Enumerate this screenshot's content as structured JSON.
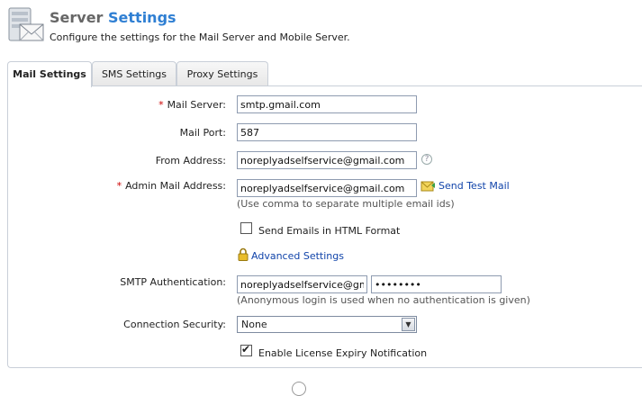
{
  "header": {
    "title_part1": "Server",
    "title_part2": "Settings",
    "subtitle": "Configure the settings for the Mail Server and Mobile Server."
  },
  "tabs": [
    {
      "label": "Mail Settings",
      "active": true
    },
    {
      "label": "SMS Settings",
      "active": false
    },
    {
      "label": "Proxy Settings",
      "active": false
    }
  ],
  "form": {
    "required_mark": "*",
    "mail_server": {
      "label": "Mail Server:",
      "value": "smtp.gmail.com"
    },
    "mail_port": {
      "label": "Mail Port:",
      "value": "587"
    },
    "from_address": {
      "label": "From Address:",
      "value": "noreplyadselfservice@gmail.com",
      "help": "?"
    },
    "admin_mail": {
      "label": "Admin Mail Address:",
      "value": "noreplyadselfservice@gmail.com",
      "send_test_label": "Send Test Mail",
      "hint": "(Use comma to separate multiple email ids)"
    },
    "html_format": {
      "label": "Send Emails in HTML Format",
      "checked": false
    },
    "advanced_label": "Advanced Settings",
    "smtp_auth": {
      "label": "SMTP Authentication:",
      "username": "noreplyadselfservice@gmail.com",
      "password": "••••••••",
      "hint": "(Anonymous login is used when no authentication is given)"
    },
    "connection_security": {
      "label": "Connection Security:",
      "value": "None"
    },
    "license_expiry": {
      "label": "Enable License Expiry Notification",
      "checked": true
    }
  },
  "icons": {
    "header": "mail-server-icon",
    "send_test": "mail-envelope-icon",
    "advanced": "lock-icon",
    "help": "help-icon",
    "dropdown": "chevron-down-icon"
  },
  "colors": {
    "title_accent": "#2f7fd3",
    "required": "#cc0000",
    "link": "#1144aa"
  }
}
